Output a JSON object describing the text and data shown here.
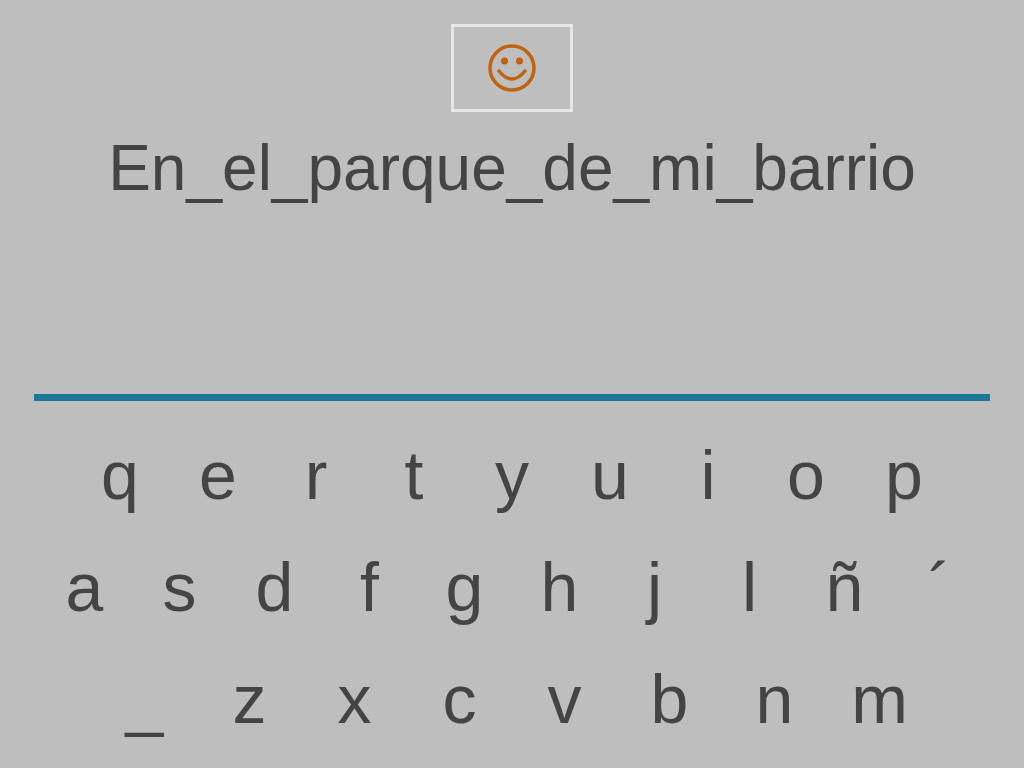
{
  "phrase": "En_el_parque_de_mi_barrio",
  "keyboard": {
    "rows": [
      [
        "q",
        "e",
        "r",
        "t",
        "y",
        "u",
        "i",
        "o",
        "p"
      ],
      [
        "a",
        "s",
        "d",
        "f",
        "g",
        "h",
        "j",
        "l",
        "ñ",
        "´"
      ],
      [
        "_",
        "z",
        "x",
        "c",
        "v",
        "b",
        "n",
        "m"
      ]
    ]
  }
}
